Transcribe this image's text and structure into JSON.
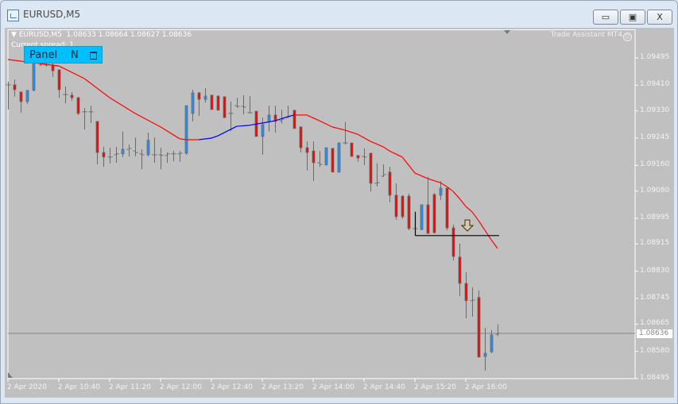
{
  "window": {
    "title": "EURUSD,M5",
    "buttons": {
      "minimize": "▭",
      "maximize": "▣",
      "close": "X"
    }
  },
  "chart_header": {
    "symbol": "EURUSD,M5",
    "ohlc": "1.08633 1.08664 1.08627 1.08636",
    "spread": "Current spread: 1",
    "indicator": "Trade Assistant MT4"
  },
  "panel": {
    "label": "Panel",
    "mode": "N"
  },
  "colors": {
    "background": "#c0c0c0",
    "bear_body": "#ff0000",
    "bull_body": "#1e90ff",
    "bar": "#6b6b6b",
    "ma_down": "#ff0000",
    "ma_up": "#0000ff",
    "panel": "#00bfff"
  },
  "chart_data": {
    "type": "candlestick",
    "date": "2 Apr 2020",
    "timeframe": "M5",
    "ylim": [
      1.08495,
      1.09495
    ],
    "y_ticks": [
      "1.09495",
      "1.09410",
      "1.09330",
      "1.09245",
      "1.09160",
      "1.09080",
      "1.08995",
      "1.08915",
      "1.08830",
      "1.08745",
      "1.08665",
      "1.08580",
      "1.08495"
    ],
    "x_ticks": [
      [
        "10:00",
        "2 Apr 2020"
      ],
      [
        "10:40",
        "2 Apr 10:40"
      ],
      [
        "11:20",
        "2 Apr 11:20"
      ],
      [
        "12:00",
        "2 Apr 12:00"
      ],
      [
        "12:40",
        "2 Apr 12:40"
      ],
      [
        "13:20",
        "2 Apr 13:20"
      ],
      [
        "14:00",
        "2 Apr 14:00"
      ],
      [
        "14:40",
        "2 Apr 14:40"
      ],
      [
        "15:20",
        "2 Apr 15:20"
      ],
      [
        "16:00",
        "2 Apr 16:00"
      ]
    ],
    "current_price": "1.08636",
    "candles_columns": [
      "time",
      "open",
      "high",
      "low",
      "close"
    ],
    "candles": [
      [
        "10:00",
        1.09411,
        1.09421,
        1.09334,
        1.09411
      ],
      [
        "10:05",
        1.09411,
        1.09428,
        1.09374,
        1.09396
      ],
      [
        "10:10",
        1.09389,
        1.09389,
        1.09324,
        1.09359
      ],
      [
        "10:15",
        1.09359,
        1.09394,
        1.09351,
        1.09394
      ],
      [
        "10:20",
        1.09394,
        1.09483,
        1.09391,
        1.09483
      ],
      [
        "10:25",
        1.09478,
        1.09495,
        1.0947,
        1.09473
      ],
      [
        "10:30",
        1.09473,
        1.0949,
        1.09468,
        1.09473
      ],
      [
        "10:35",
        1.09473,
        1.0949,
        1.09436,
        1.09455
      ],
      [
        "10:40",
        1.09458,
        1.09458,
        1.09371,
        1.09396
      ],
      [
        "10:45",
        1.09381,
        1.09406,
        1.09354,
        1.09381
      ],
      [
        "10:50",
        1.09379,
        1.09389,
        1.09361,
        1.09371
      ],
      [
        "10:55",
        1.09371,
        1.09374,
        1.09317,
        1.09322
      ],
      [
        "11:00",
        1.09327,
        1.09339,
        1.09272,
        1.09327
      ],
      [
        "11:05",
        1.09327,
        1.09346,
        1.09292,
        1.09327
      ],
      [
        "11:10",
        1.09297,
        1.09297,
        1.09163,
        1.092
      ],
      [
        "11:15",
        1.092,
        1.09218,
        1.09156,
        1.09186
      ],
      [
        "11:20",
        1.09186,
        1.09215,
        1.09166,
        1.09186
      ],
      [
        "11:25",
        1.09193,
        1.09218,
        1.09168,
        1.09196
      ],
      [
        "11:30",
        1.09196,
        1.09265,
        1.09186,
        1.0921
      ],
      [
        "11:35",
        1.0921,
        1.09225,
        1.09188,
        1.09213
      ],
      [
        "11:40",
        1.09205,
        1.09247,
        1.09188,
        1.092
      ],
      [
        "11:45",
        1.09196,
        1.0921,
        1.09148,
        1.09193
      ],
      [
        "11:50",
        1.09193,
        1.09262,
        1.09188,
        1.09238
      ],
      [
        "11:55",
        1.09193,
        1.09247,
        1.09168,
        1.09193
      ],
      [
        "12:00",
        1.09193,
        1.09215,
        1.09148,
        1.09191
      ],
      [
        "12:05",
        1.09191,
        1.092,
        1.09168,
        1.09196
      ],
      [
        "12:10",
        1.09196,
        1.09205,
        1.09173,
        1.09196
      ],
      [
        "12:15",
        1.09196,
        1.09205,
        1.09171,
        1.09198
      ],
      [
        "12:20",
        1.09198,
        1.09346,
        1.09193,
        1.09346
      ],
      [
        "12:25",
        1.09322,
        1.09396,
        1.09297,
        1.09386
      ],
      [
        "12:30",
        1.09386,
        1.09389,
        1.09314,
        1.09366
      ],
      [
        "12:35",
        1.09366,
        1.09401,
        1.09356,
        1.09376
      ],
      [
        "12:40",
        1.09379,
        1.09379,
        1.09334,
        1.09334
      ],
      [
        "12:45",
        1.09376,
        1.09379,
        1.09332,
        1.09332
      ],
      [
        "12:50",
        1.09374,
        1.09374,
        1.09309,
        1.09309
      ],
      [
        "12:55",
        1.09322,
        1.09359,
        1.09267,
        1.09322
      ],
      [
        "13:00",
        1.09346,
        1.09371,
        1.09339,
        1.09344
      ],
      [
        "13:05",
        1.09344,
        1.09379,
        1.09319,
        1.09342
      ],
      [
        "13:10",
        1.09324,
        1.09376,
        1.09324,
        1.09324
      ],
      [
        "13:15",
        1.09329,
        1.09329,
        1.0925,
        1.0925
      ],
      [
        "13:20",
        1.0925,
        1.09309,
        1.09193,
        1.09287
      ],
      [
        "13:25",
        1.09295,
        1.09346,
        1.09265,
        1.09317
      ],
      [
        "13:30",
        1.09317,
        1.09346,
        1.09262,
        1.09297
      ],
      [
        "13:35",
        1.09299,
        1.09334,
        1.0929,
        1.09304
      ],
      [
        "13:40",
        1.09309,
        1.09346,
        1.09307,
        1.09312
      ],
      [
        "13:45",
        1.09332,
        1.09332,
        1.09275,
        1.09275
      ],
      [
        "13:50",
        1.0928,
        1.0928,
        1.092,
        1.09215
      ],
      [
        "13:55",
        1.09215,
        1.09235,
        1.09144,
        1.092
      ],
      [
        "14:00",
        1.09205,
        1.09235,
        1.09111,
        1.09168
      ],
      [
        "14:05",
        1.09168,
        1.09205,
        1.09156,
        1.09163
      ],
      [
        "14:10",
        1.09161,
        1.09215,
        1.09161,
        1.09215
      ],
      [
        "14:15",
        1.09213,
        1.09213,
        1.09139,
        1.09139
      ],
      [
        "14:20",
        1.09139,
        1.0923,
        1.09139,
        1.0923
      ],
      [
        "14:25",
        1.0923,
        1.09295,
        1.09225,
        1.0923
      ],
      [
        "14:30",
        1.0923,
        1.0923,
        1.09188,
        1.09188
      ],
      [
        "14:35",
        1.09191,
        1.09191,
        1.09171,
        1.09183
      ],
      [
        "14:40",
        1.09188,
        1.09213,
        1.09161,
        1.09186
      ],
      [
        "14:45",
        1.09198,
        1.09198,
        1.09079,
        1.09104
      ],
      [
        "14:50",
        1.09104,
        1.09166,
        1.09094,
        1.09106
      ],
      [
        "14:55",
        1.09126,
        1.09163,
        1.09124,
        1.09131
      ],
      [
        "15:00",
        1.09139,
        1.09156,
        1.09045,
        1.09067
      ],
      [
        "15:05",
        1.09067,
        1.09104,
        1.0899,
        1.09
      ],
      [
        "15:10",
        1.09064,
        1.09067,
        1.08993,
        1.09
      ],
      [
        "15:15",
        1.09064,
        1.09072,
        1.08958,
        1.08963
      ],
      [
        "15:20",
        1.08963,
        1.09015,
        1.08941,
        1.08963
      ],
      [
        "15:25",
        1.0896,
        1.09037,
        1.08958,
        1.09037
      ],
      [
        "15:30",
        1.09037,
        1.09124,
        1.08946,
        1.08948
      ],
      [
        "15:35",
        1.09069,
        1.09074,
        1.08948,
        1.0895
      ],
      [
        "15:40",
        1.09067,
        1.09111,
        1.09052,
        1.09089
      ],
      [
        "15:45",
        1.09089,
        1.09089,
        1.08958,
        1.08965
      ],
      [
        "15:50",
        1.08965,
        1.08975,
        1.08864,
        1.08876
      ],
      [
        "15:55",
        1.08874,
        1.08916,
        1.08752,
        1.08792
      ],
      [
        "16:00",
        1.08792,
        1.08827,
        1.08683,
        1.08738
      ],
      [
        "16:05",
        1.08738,
        1.0878,
        1.08688,
        1.0874
      ],
      [
        "16:10",
        1.08748,
        1.0877,
        1.08562,
        1.08562
      ],
      [
        "16:15",
        1.08564,
        1.08653,
        1.0852,
        1.08574
      ],
      [
        "16:20",
        1.08579,
        1.08646,
        1.08574,
        1.08631
      ],
      [
        "16:25",
        1.08633,
        1.08664,
        1.08627,
        1.08636
      ]
    ],
    "moving_average": {
      "up_color_range": [
        "12:30",
        "13:50"
      ],
      "points": [
        [
          "10:00",
          1.0949
        ],
        [
          "10:20",
          1.0948
        ],
        [
          "10:40",
          1.0947
        ],
        [
          "11:00",
          1.09431
        ],
        [
          "11:20",
          1.09371
        ],
        [
          "11:40",
          1.09322
        ],
        [
          "12:00",
          1.0928
        ],
        [
          "12:15",
          1.09243
        ],
        [
          "12:20",
          1.0924
        ],
        [
          "12:30",
          1.0924
        ],
        [
          "12:40",
          1.09245
        ],
        [
          "12:45",
          1.09252
        ],
        [
          "13:00",
          1.09282
        ],
        [
          "13:10",
          1.09285
        ],
        [
          "13:20",
          1.09292
        ],
        [
          "13:30",
          1.09299
        ],
        [
          "13:40",
          1.09312
        ],
        [
          "13:45",
          1.09317
        ],
        [
          "13:55",
          1.09317
        ],
        [
          "14:05",
          1.09299
        ],
        [
          "14:15",
          1.0928
        ],
        [
          "14:25",
          1.0927
        ],
        [
          "14:35",
          1.09257
        ],
        [
          "14:45",
          1.09235
        ],
        [
          "14:55",
          1.09218
        ],
        [
          "15:00",
          1.09205
        ],
        [
          "15:10",
          1.09186
        ],
        [
          "15:20",
          1.09136
        ],
        [
          "15:30",
          1.09119
        ],
        [
          "15:40",
          1.09106
        ],
        [
          "15:45",
          1.09094
        ],
        [
          "15:50",
          1.09079
        ],
        [
          "15:55",
          1.09057
        ],
        [
          "16:00",
          1.09032
        ],
        [
          "16:05",
          1.09015
        ],
        [
          "16:10",
          1.08988
        ],
        [
          "16:15",
          1.08958
        ],
        [
          "16:20",
          1.08928
        ],
        [
          "16:25",
          1.08901
        ]
      ]
    },
    "support_line": {
      "price": 1.08941,
      "from": "15:20",
      "to": "16:20"
    },
    "sell_arrow": {
      "time": "16:00",
      "price": 1.08975
    }
  }
}
